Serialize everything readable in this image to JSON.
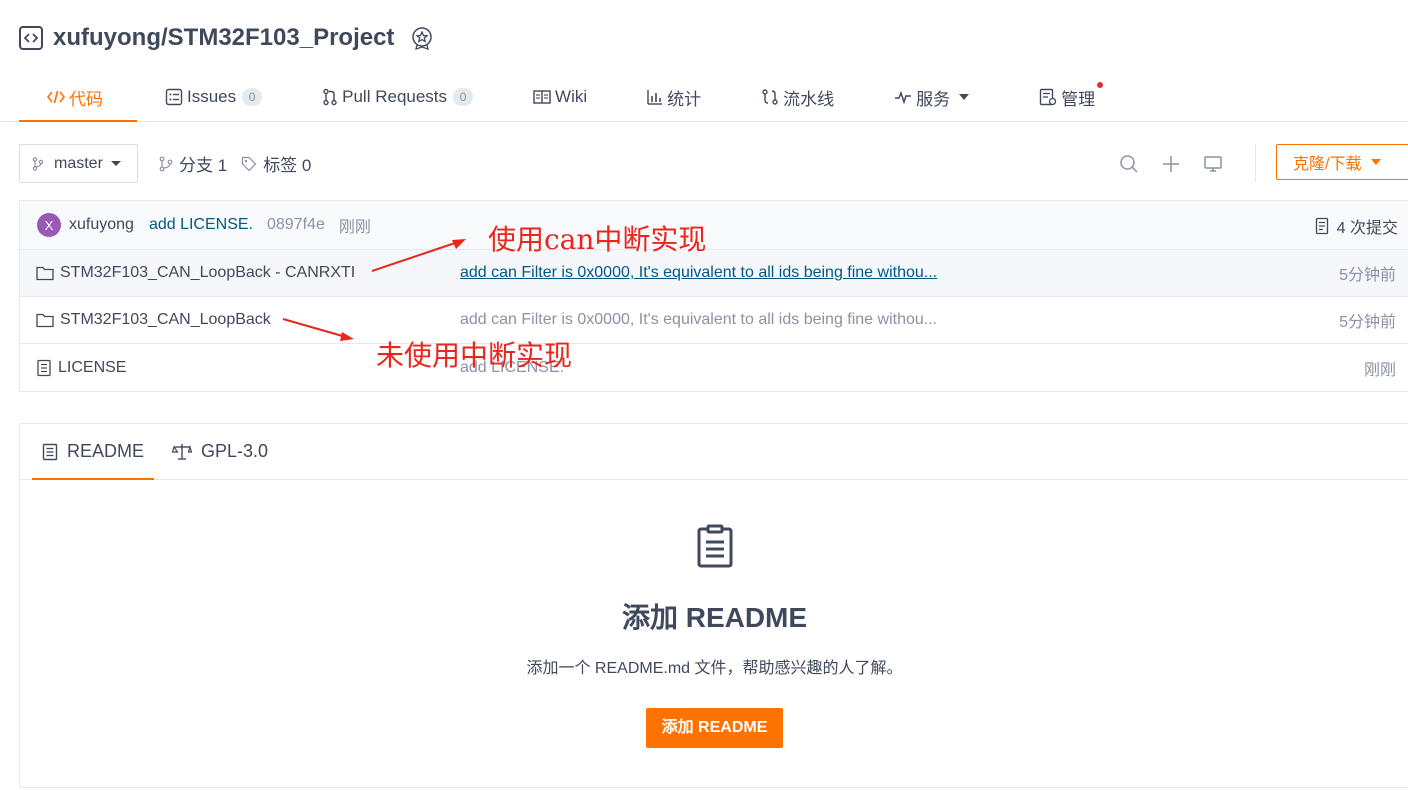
{
  "repo": {
    "title": "xufuyong/STM32F103_Project",
    "repo_icon": "code-brackets-icon",
    "badge_icon": "award-badge-icon"
  },
  "tabs": [
    {
      "label": "代码",
      "icon": "code-icon",
      "active": true
    },
    {
      "label": "Issues",
      "icon": "issues-icon",
      "count": "0"
    },
    {
      "label": "Pull Requests",
      "icon": "pull-request-icon",
      "count": "0"
    },
    {
      "label": "Wiki",
      "icon": "book-icon"
    },
    {
      "label": "统计",
      "icon": "bar-chart-icon"
    },
    {
      "label": "流水线",
      "icon": "pipeline-icon"
    },
    {
      "label": "服务",
      "icon": "pulse-icon",
      "dropdown": true
    },
    {
      "label": "管理",
      "icon": "manage-icon",
      "notify": true
    }
  ],
  "toolbar": {
    "branch": "master",
    "branches_label": "分支 1",
    "tags_label": "标签 0",
    "clone_label": "克隆/下载"
  },
  "commit": {
    "avatar_letter": "X",
    "author": "xufuyong",
    "message": "add LICENSE.",
    "sha": "0897f4e",
    "time": "刚刚",
    "count_label": "4 次提交"
  },
  "files": [
    {
      "name": "STM32F103_CAN_LoopBack - CANRXTI",
      "type": "folder",
      "commit": "add can Filter is 0x0000, It's equivalent to all ids being fine withou...",
      "time": "5分钟前"
    },
    {
      "name": "STM32F103_CAN_LoopBack",
      "type": "folder",
      "commit": "add can Filter is 0x0000, It's equivalent to all ids being fine withou...",
      "time": "5分钟前"
    },
    {
      "name": "LICENSE",
      "type": "file",
      "commit": "add LICENSE.",
      "time": "刚刚"
    }
  ],
  "readme": {
    "tabs": [
      {
        "label": "README",
        "icon": "document-icon"
      },
      {
        "label": "GPL-3.0",
        "icon": "scale-icon"
      }
    ],
    "empty_title": "添加 README",
    "empty_desc": "添加一个 README.md 文件，帮助感兴趣的人了解。",
    "button_label": "添加 README"
  },
  "annotations": {
    "top": "使用can中断实现",
    "bottom": "未使用中断实现",
    "color": "#e8261c"
  },
  "colors": {
    "accent": "#fe7300",
    "text": "#40485b",
    "link": "#005980",
    "muted": "#8c92a4"
  }
}
